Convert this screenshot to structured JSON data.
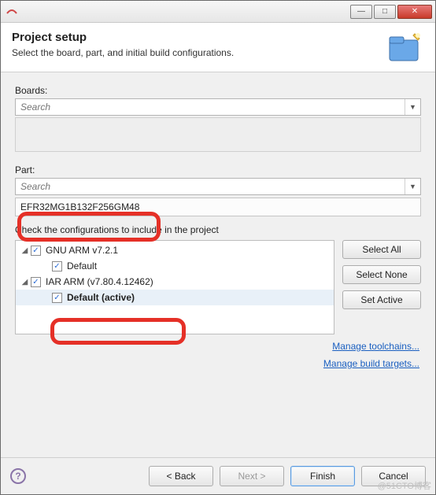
{
  "titlebar": {
    "minimize": "—",
    "maximize": "□",
    "close": "✕"
  },
  "header": {
    "title": "Project setup",
    "subtitle": "Select the board, part, and initial build configurations."
  },
  "boards": {
    "label": "Boards:",
    "placeholder": "Search"
  },
  "part": {
    "label": "Part:",
    "placeholder": "Search",
    "value": "EFR32MG1B132F256GM48"
  },
  "config": {
    "hint": "Check the configurations to include in the project",
    "tree": {
      "n0": {
        "label": "GNU ARM v7.2.1"
      },
      "n0c": {
        "label": "Default"
      },
      "n1": {
        "label": "IAR ARM (v7.80.4.12462)"
      },
      "n1c": {
        "label": "Default (active)"
      }
    },
    "buttons": {
      "select_all": "Select All",
      "select_none": "Select None",
      "set_active": "Set Active"
    },
    "links": {
      "toolchains": "Manage toolchains...",
      "targets": "Manage build targets..."
    }
  },
  "footer": {
    "back": "< Back",
    "next": "Next >",
    "finish": "Finish",
    "cancel": "Cancel"
  },
  "watermark": "@51CTO博客"
}
